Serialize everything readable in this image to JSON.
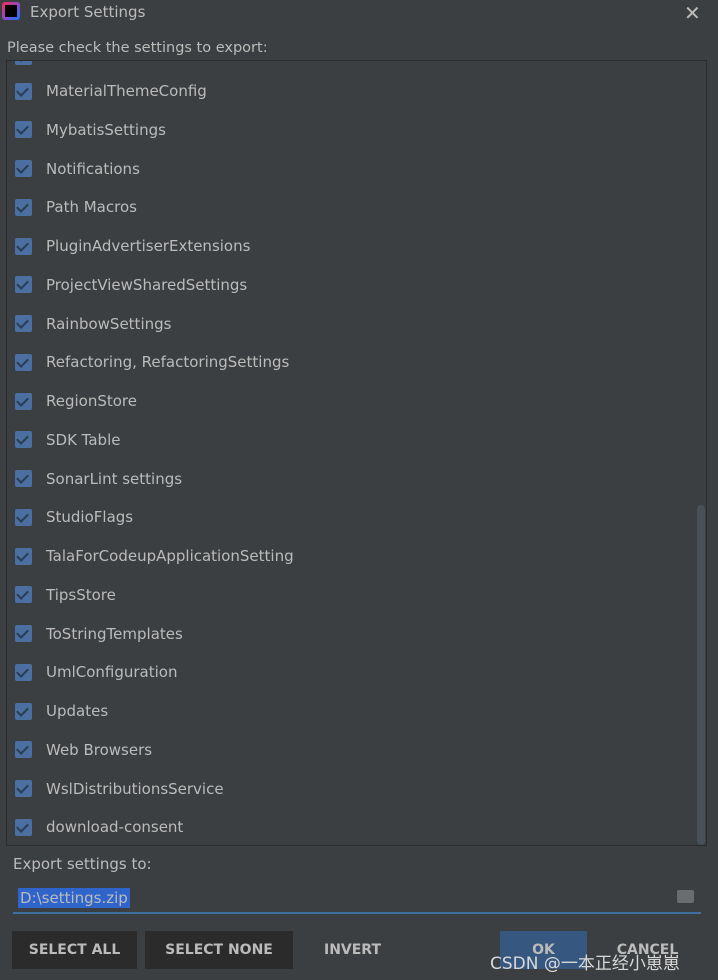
{
  "window": {
    "title": "Export Settings",
    "close_icon": "close-icon"
  },
  "prompt": "Please check the settings to export:",
  "items": [
    {
      "label": "MaterialThemeConfig",
      "checked": true
    },
    {
      "label": "MybatisSettings",
      "checked": true
    },
    {
      "label": "Notifications",
      "checked": true
    },
    {
      "label": "Path Macros",
      "checked": true
    },
    {
      "label": "PluginAdvertiserExtensions",
      "checked": true
    },
    {
      "label": "ProjectViewSharedSettings",
      "checked": true
    },
    {
      "label": "RainbowSettings",
      "checked": true
    },
    {
      "label": "Refactoring, RefactoringSettings",
      "checked": true
    },
    {
      "label": "RegionStore",
      "checked": true
    },
    {
      "label": "SDK Table",
      "checked": true
    },
    {
      "label": "SonarLint settings",
      "checked": true
    },
    {
      "label": "StudioFlags",
      "checked": true
    },
    {
      "label": "TalaForCodeupApplicationSetting",
      "checked": true
    },
    {
      "label": "TipsStore",
      "checked": true
    },
    {
      "label": "ToStringTemplates",
      "checked": true
    },
    {
      "label": "UmlConfiguration",
      "checked": true
    },
    {
      "label": "Updates",
      "checked": true
    },
    {
      "label": "Web Browsers",
      "checked": true
    },
    {
      "label": "WslDistributionsService",
      "checked": true
    },
    {
      "label": "download-consent",
      "checked": true
    }
  ],
  "export": {
    "label": "Export settings to:",
    "path": "D:\\settings.zip"
  },
  "buttons": {
    "select_all": "SELECT ALL",
    "select_none": "SELECT NONE",
    "invert": "INVERT",
    "ok": "OK",
    "cancel": "CANCEL"
  },
  "watermark": "CSDN @一本正经小崽崽",
  "colors": {
    "background": "#3c3f41",
    "checkbox": "#4a6fa0",
    "ok_button": "#365880",
    "selection": "#2f65ca"
  }
}
